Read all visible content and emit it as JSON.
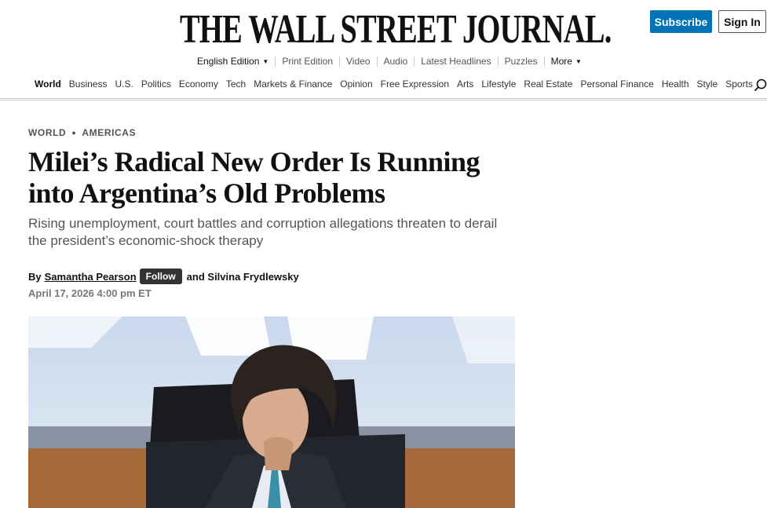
{
  "header": {
    "logo_text": "THE WALL STREET JOURNAL.",
    "subscribe_label": "Subscribe",
    "signin_label": "Sign In",
    "edition": {
      "current": "English Edition",
      "links": [
        "Print Edition",
        "Video",
        "Audio",
        "Latest Headlines",
        "Puzzles"
      ],
      "more_label": "More"
    }
  },
  "nav": {
    "items": [
      "World",
      "Business",
      "U.S.",
      "Politics",
      "Economy",
      "Tech",
      "Markets & Finance",
      "Opinion",
      "Free Expression",
      "Arts",
      "Lifestyle",
      "Real Estate",
      "Personal Finance",
      "Health",
      "Style",
      "Sports"
    ],
    "active": "World",
    "search_icon": "search-icon"
  },
  "article": {
    "breadcrumb": [
      "WORLD",
      "AMERICAS"
    ],
    "headline": "Milei’s Radical New Order Is Running into Argentina’s Old Problems",
    "dek": "Rising unemployment, court battles and corruption allegations threaten to derail the president’s economic-shock therapy",
    "byline_prefix": "By",
    "author_primary": "Samantha Pearson",
    "follow_label": "Follow",
    "author_secondary": "and Silvina Frydlewsky",
    "timestamp": "April 17, 2026 4:00 pm ET"
  },
  "colors": {
    "subscribe_bg": "#0274b6",
    "follow_bg": "#333333",
    "text": "#111111",
    "muted": "#555555"
  }
}
